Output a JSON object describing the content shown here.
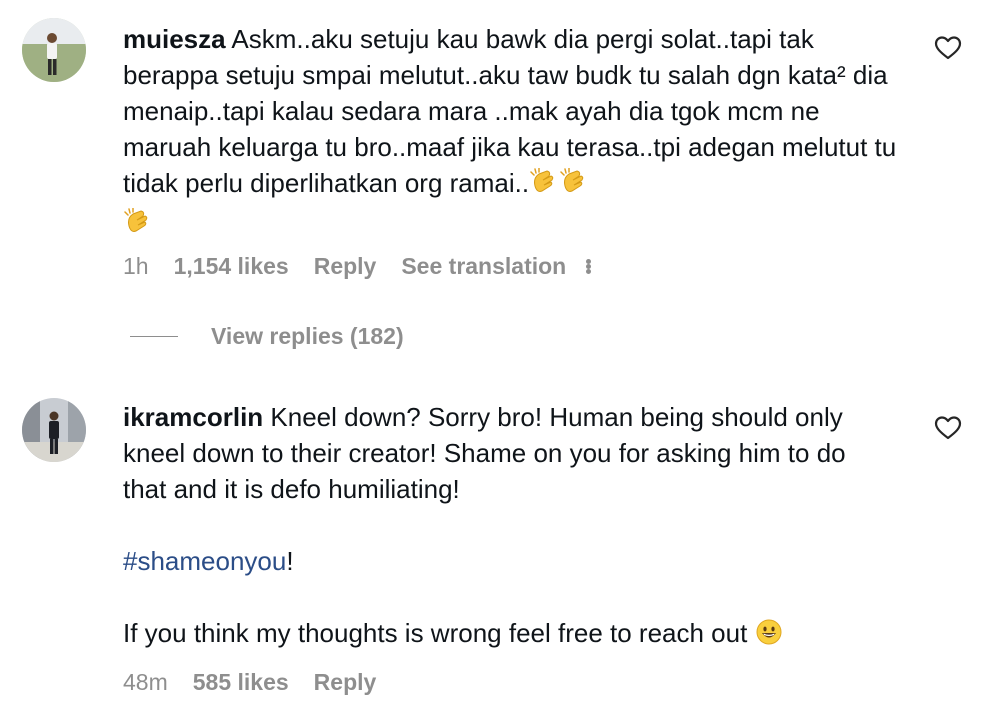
{
  "comments": [
    {
      "username": "muiesza",
      "text": "Askm..aku setuju kau bawk dia pergi solat..tapi tak berappa setuju smpai melutut..aku taw budk tu salah dgn kata² dia menaip..tapi kalau sedara mara ..mak ayah dia tgok mcm ne maruah keluarga tu bro..maaf jika kau terasa..tpi adegan melutut tu tidak perlu diperlihatkan org ramai..",
      "trailing_emojis": [
        "clapping-hands",
        "clapping-hands",
        "clapping-hands"
      ],
      "time": "1h",
      "likes": "1,154 likes",
      "reply": "Reply",
      "translate": "See translation",
      "view_replies": "View replies (182)"
    },
    {
      "username": "ikramcorlin",
      "text_line1": "Kneel down? Sorry bro! Human being should only kneel down to their creator! Shame on you for asking him to do that and it is defo humiliating!",
      "hashtag": "#shameonyou",
      "hashtag_suffix": "!",
      "text_line3": "If you think my thoughts is wrong feel free to reach out",
      "trailing_emoji": "grinning-face",
      "time": "48m",
      "likes": "585 likes",
      "reply": "Reply"
    }
  ],
  "icons": {
    "like": "heart-outline-icon",
    "more": "more-options-icon"
  }
}
